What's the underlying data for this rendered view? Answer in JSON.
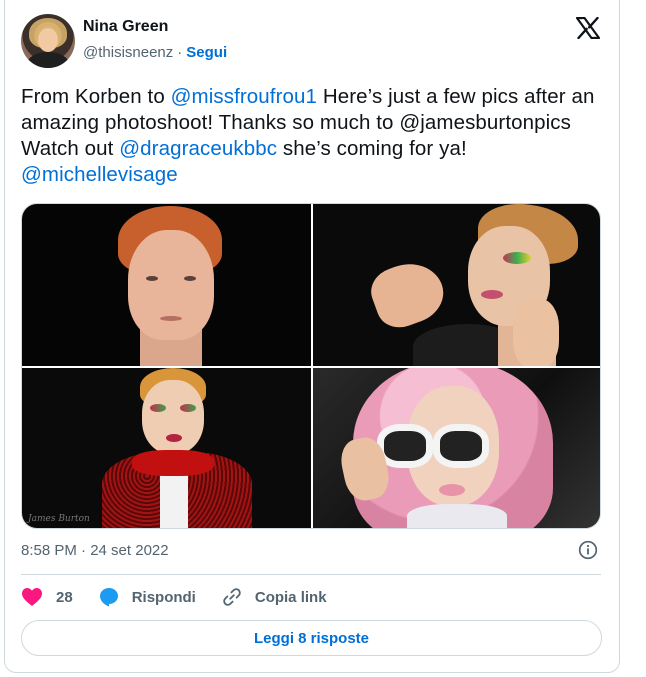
{
  "author": {
    "name": "Nina Green",
    "handle": "@thisisneenz",
    "separator": "·",
    "follow_label": "Segui",
    "avatar_icon": "profile-photo"
  },
  "tweet": {
    "parts": [
      {
        "text": "From Korben to ",
        "type": "text"
      },
      {
        "text": "@missfroufrou1",
        "type": "mention"
      },
      {
        "text": " Here’s just a few pics after an amazing photoshoot! Thanks so much to @jamesburtonpics Watch out ",
        "type": "text"
      },
      {
        "text": "@dragraceukbbc",
        "type": "mention"
      },
      {
        "text": " she’s coming for ya! ",
        "type": "text"
      },
      {
        "text": "@michellevisage",
        "type": "mention"
      }
    ],
    "timestamp": "8:58 PM · 24 set 2022",
    "photo_signature": "James Burton"
  },
  "actions": {
    "like_count": "28",
    "reply_label": "Rispondi",
    "copy_link_label": "Copia link"
  },
  "read_more_label": "Leggi 8 risposte",
  "colors": {
    "accent": "#006fd6",
    "like": "#f91880",
    "reply": "#1d9bf0",
    "muted": "#536471",
    "border": "#cfd9de"
  },
  "icons": {
    "brand": "x-logo-icon",
    "info": "info-icon",
    "like": "heart-icon",
    "reply": "speech-bubble-icon",
    "copy": "link-icon"
  }
}
